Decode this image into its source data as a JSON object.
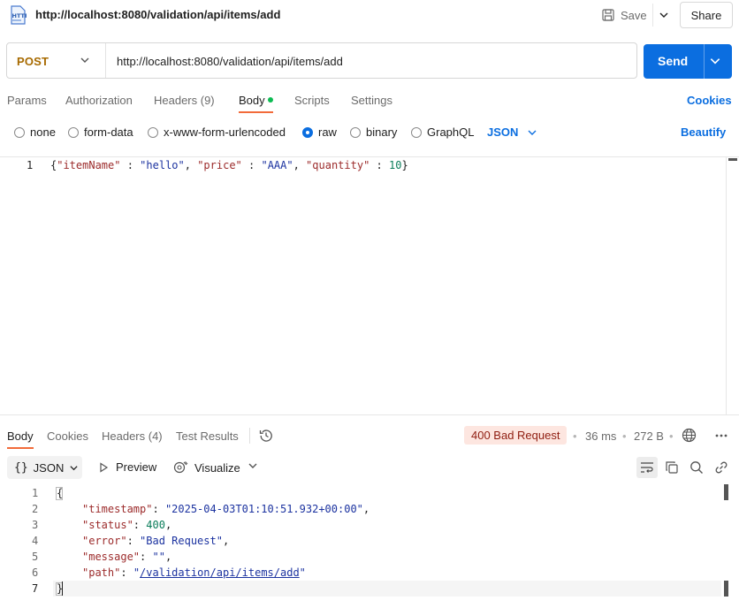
{
  "header": {
    "title": "http://localhost:8080/validation/api/items/add",
    "save_label": "Save",
    "share_label": "Share"
  },
  "request": {
    "method": "POST",
    "url": "http://localhost:8080/validation/api/items/add",
    "send_label": "Send",
    "tabs": [
      "Params",
      "Authorization",
      "Headers (9)",
      "Body",
      "Scripts",
      "Settings"
    ],
    "cookies_label": "Cookies",
    "body_types": [
      "none",
      "form-data",
      "x-www-form-urlencoded",
      "raw",
      "binary",
      "GraphQL"
    ],
    "selected_body_type": "raw",
    "format": "JSON",
    "beautify_label": "Beautify",
    "line_numbers": [
      "1"
    ],
    "body_tokens": {
      "open": "{",
      "k1": "\"itemName\"",
      "sep1": " : ",
      "v1": "\"hello\"",
      "c1": ", ",
      "k2": "\"price\"",
      "sep2": " : ",
      "v2": "\"AAA\"",
      "c2": ", ",
      "k3": "\"quantity\"",
      "sep3": " : ",
      "v3": "10",
      "close": "}"
    }
  },
  "response": {
    "tabs": [
      "Body",
      "Cookies",
      "Headers (4)",
      "Test Results"
    ],
    "status": "400 Bad Request",
    "time": "36 ms",
    "size": "272 B",
    "format": "JSON",
    "preview_label": "Preview",
    "visualize_label": "Visualize",
    "line_numbers": [
      "1",
      "2",
      "3",
      "4",
      "5",
      "6",
      "7"
    ],
    "body": {
      "open": "{",
      "k_timestamp": "\"timestamp\"",
      "v_timestamp": "\"2025-04-03T01:10:51.932+00:00\"",
      "k_status": "\"status\"",
      "v_status": "400",
      "k_error": "\"error\"",
      "v_error": "\"Bad Request\"",
      "k_message": "\"message\"",
      "v_message": "\"\"",
      "k_path": "\"path\"",
      "q": "\"",
      "v_path_link": "/validation/api/items/add",
      "close": "}",
      "colon": ": ",
      "comma": ","
    }
  },
  "colors": {
    "accent": "#0b6ee0",
    "method": "#a76a00",
    "tab_underline": "#f26b3a",
    "status_bg": "#fde6e0",
    "status_text": "#8f1d10",
    "active_dot": "#0cbb52"
  },
  "icons": [
    "http-file-icon",
    "save-icon",
    "chevron-down-icon",
    "history-icon",
    "globe-icon",
    "more-icon",
    "braces-icon",
    "play-icon",
    "visualize-icon",
    "wrap-icon",
    "copy-icon",
    "search-icon",
    "link-icon"
  ]
}
